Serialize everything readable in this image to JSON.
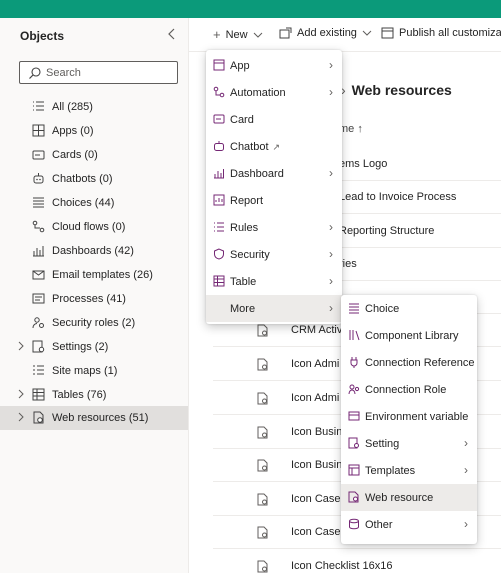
{
  "colors": {
    "accent": "#0b9a7a",
    "icon": "#742774",
    "selected": "#e1dfdd",
    "hover": "#edebe9"
  },
  "sidebar": {
    "title": "Objects",
    "collapse_icon": "chevron-left-icon",
    "search_placeholder": "Search",
    "items": [
      {
        "label": "All  (285)",
        "icon": "list-icon"
      },
      {
        "label": "Apps  (0)",
        "icon": "apps-grid-icon"
      },
      {
        "label": "Cards  (0)",
        "icon": "card-icon"
      },
      {
        "label": "Chatbots  (0)",
        "icon": "chatbot-icon"
      },
      {
        "label": "Choices  (44)",
        "icon": "choice-list-icon"
      },
      {
        "label": "Cloud flows  (0)",
        "icon": "cloud-flow-icon"
      },
      {
        "label": "Dashboards  (42)",
        "icon": "dashboard-icon"
      },
      {
        "label": "Email templates  (26)",
        "icon": "mail-icon"
      },
      {
        "label": "Processes  (41)",
        "icon": "process-icon"
      },
      {
        "label": "Security roles  (2)",
        "icon": "security-role-icon"
      },
      {
        "label": "Settings  (2)",
        "icon": "settings-icon"
      },
      {
        "label": "Site maps  (1)",
        "icon": "site-map-icon"
      },
      {
        "label": "Tables  (76)",
        "icon": "table-icon"
      },
      {
        "label": "Web resources  (51)",
        "icon": "web-resource-icon"
      }
    ]
  },
  "toolbar": {
    "new_label": "New",
    "add_existing_label": "Add existing",
    "publish_label": "Publish all customizations"
  },
  "breadcrumb": {
    "current": "Web resources"
  },
  "table": {
    "header": "me ↑",
    "rows": [
      "ems Logo",
      "Lead to Invoice Process",
      "Reporting Structure",
      "ries",
      "",
      "CRM Activi",
      "Icon Admi",
      "Icon Admi",
      "Icon Busine",
      "Icon Busine",
      "Icon Case C",
      "Icon Case C",
      "Icon Checklist 16x16"
    ]
  },
  "new_menu": {
    "items": [
      {
        "label": "App",
        "icon": "app-icon",
        "submenu": true
      },
      {
        "label": "Automation",
        "icon": "automation-icon",
        "submenu": true
      },
      {
        "label": "Card",
        "icon": "card-icon",
        "submenu": false
      },
      {
        "label": "Chatbot",
        "icon": "chatbot-icon",
        "submenu": false,
        "external": true
      },
      {
        "label": "Dashboard",
        "icon": "dashboard-icon",
        "submenu": true
      },
      {
        "label": "Report",
        "icon": "report-icon",
        "submenu": false
      },
      {
        "label": "Rules",
        "icon": "rules-icon",
        "submenu": true
      },
      {
        "label": "Security",
        "icon": "shield-icon",
        "submenu": true
      },
      {
        "label": "Table",
        "icon": "table-icon",
        "submenu": true
      },
      {
        "label": "More",
        "icon": "",
        "submenu": true
      }
    ]
  },
  "more_menu": {
    "items": [
      {
        "label": "Choice",
        "icon": "choice-list-icon",
        "submenu": false
      },
      {
        "label": "Component Library",
        "icon": "library-icon",
        "submenu": false
      },
      {
        "label": "Connection Reference",
        "icon": "plug-icon",
        "submenu": false
      },
      {
        "label": "Connection Role",
        "icon": "people-icon",
        "submenu": false
      },
      {
        "label": "Environment variable",
        "icon": "variable-icon",
        "submenu": false
      },
      {
        "label": "Setting",
        "icon": "settings-icon",
        "submenu": true
      },
      {
        "label": "Templates",
        "icon": "template-icon",
        "submenu": true
      },
      {
        "label": "Web resource",
        "icon": "web-resource-icon",
        "submenu": false
      },
      {
        "label": "Other",
        "icon": "other-icon",
        "submenu": true
      }
    ]
  }
}
